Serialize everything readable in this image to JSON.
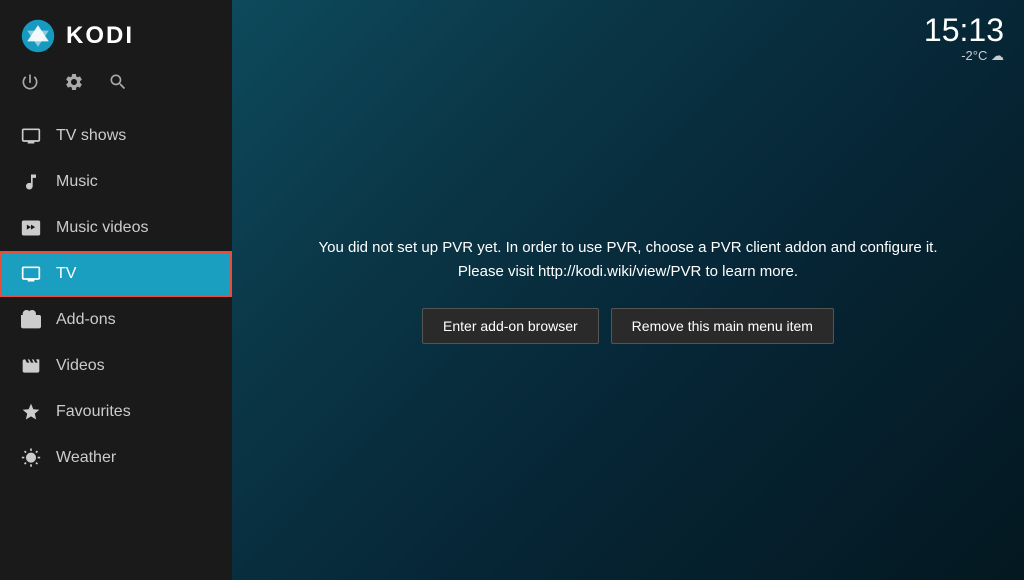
{
  "app": {
    "name": "KODI"
  },
  "clock": {
    "time": "15:13",
    "temperature": "-2°C",
    "weather_icon": "cloud"
  },
  "top_icons": [
    {
      "name": "power-icon",
      "symbol": "⏻"
    },
    {
      "name": "settings-icon",
      "symbol": "⚙"
    },
    {
      "name": "search-icon",
      "symbol": "🔍"
    }
  ],
  "nav": {
    "items": [
      {
        "id": "tv-shows",
        "label": "TV shows",
        "icon": "tv-shows-icon",
        "active": false
      },
      {
        "id": "music",
        "label": "Music",
        "icon": "music-icon",
        "active": false
      },
      {
        "id": "music-videos",
        "label": "Music videos",
        "icon": "music-videos-icon",
        "active": false
      },
      {
        "id": "tv",
        "label": "TV",
        "icon": "tv-icon",
        "active": true
      },
      {
        "id": "add-ons",
        "label": "Add-ons",
        "icon": "addons-icon",
        "active": false
      },
      {
        "id": "videos",
        "label": "Videos",
        "icon": "videos-icon",
        "active": false
      },
      {
        "id": "favourites",
        "label": "Favourites",
        "icon": "favourites-icon",
        "active": false
      },
      {
        "id": "weather",
        "label": "Weather",
        "icon": "weather-icon",
        "active": false
      }
    ]
  },
  "pvr": {
    "message_line1": "You did not set up PVR yet. In order to use PVR, choose a PVR client addon and configure it.",
    "message_line2": "Please visit http://kodi.wiki/view/PVR to learn more.",
    "btn_addon_browser": "Enter add-on browser",
    "btn_remove": "Remove this main menu item"
  }
}
